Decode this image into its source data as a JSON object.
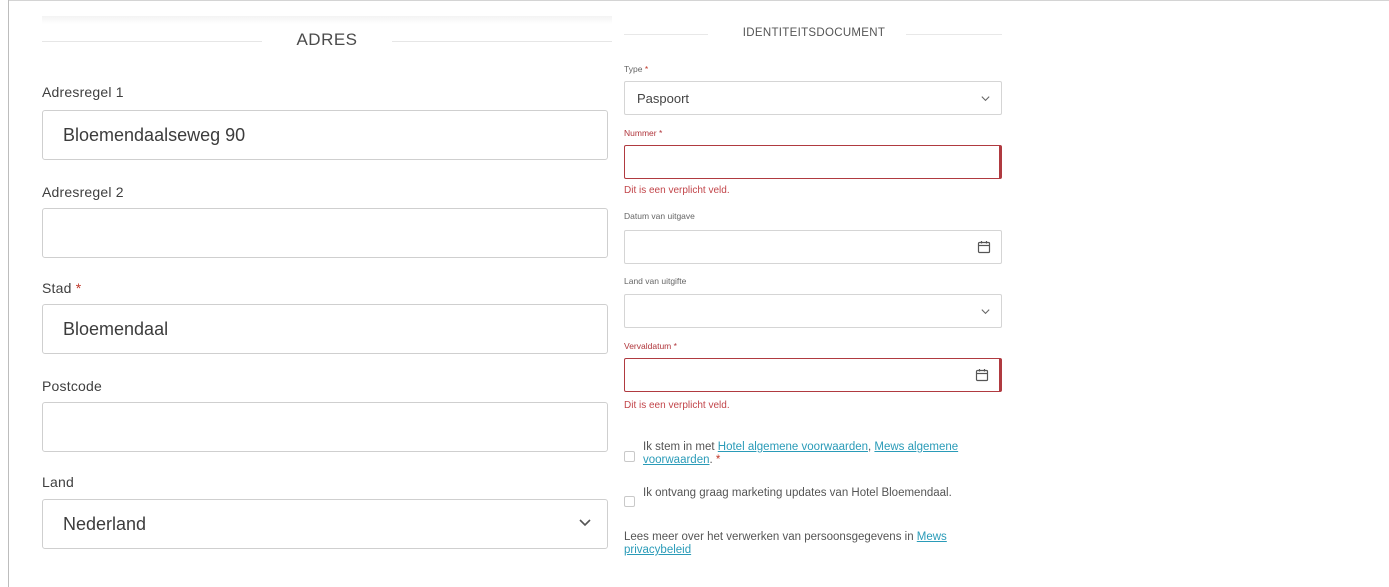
{
  "address": {
    "title": "ADRES",
    "line1": {
      "label": "Adresregel 1",
      "value": "Bloemendaalseweg 90"
    },
    "line2": {
      "label": "Adresregel 2",
      "value": ""
    },
    "city": {
      "label": "Stad",
      "required_mark": "*",
      "value": "Bloemendaal"
    },
    "postcode": {
      "label": "Postcode",
      "value": ""
    },
    "country": {
      "label": "Land",
      "value": "Nederland",
      "icon": "chevron-down-icon"
    }
  },
  "identity": {
    "title": "IDENTITEITSDOCUMENT",
    "type": {
      "label": "Type",
      "required_mark": "*",
      "value": "Paspoort",
      "icon": "chevron-down-icon"
    },
    "number": {
      "label": "Nummer",
      "required_mark": "*",
      "value": "",
      "error": "Dit is een verplicht veld."
    },
    "issue_date": {
      "label": "Datum van uitgave",
      "value": "",
      "icon": "calendar-icon"
    },
    "issue_country": {
      "label": "Land van uitgifte",
      "value": "",
      "icon": "chevron-down-icon"
    },
    "expiry": {
      "label": "Vervaldatum",
      "required_mark": "*",
      "value": "",
      "error": "Dit is een verplicht veld.",
      "icon": "calendar-icon"
    }
  },
  "consent": {
    "terms": {
      "prefix": "Ik stem in met ",
      "link1": "Hotel algemene voorwaarden",
      "sep": ", ",
      "link2": "Mews algemene voorwaarden",
      "suffix": ".",
      "required_mark": "*",
      "checked": false
    },
    "marketing": {
      "text": "Ik ontvang graag marketing updates van Hotel Bloemendaal.",
      "checked": false
    },
    "privacy": {
      "text": "Lees meer over het verwerken van persoonsgegevens in ",
      "link": "Mews privacybeleid"
    }
  },
  "colors": {
    "error": "#b0353b",
    "link": "#2a9bb8",
    "border": "#cfcfcf"
  }
}
